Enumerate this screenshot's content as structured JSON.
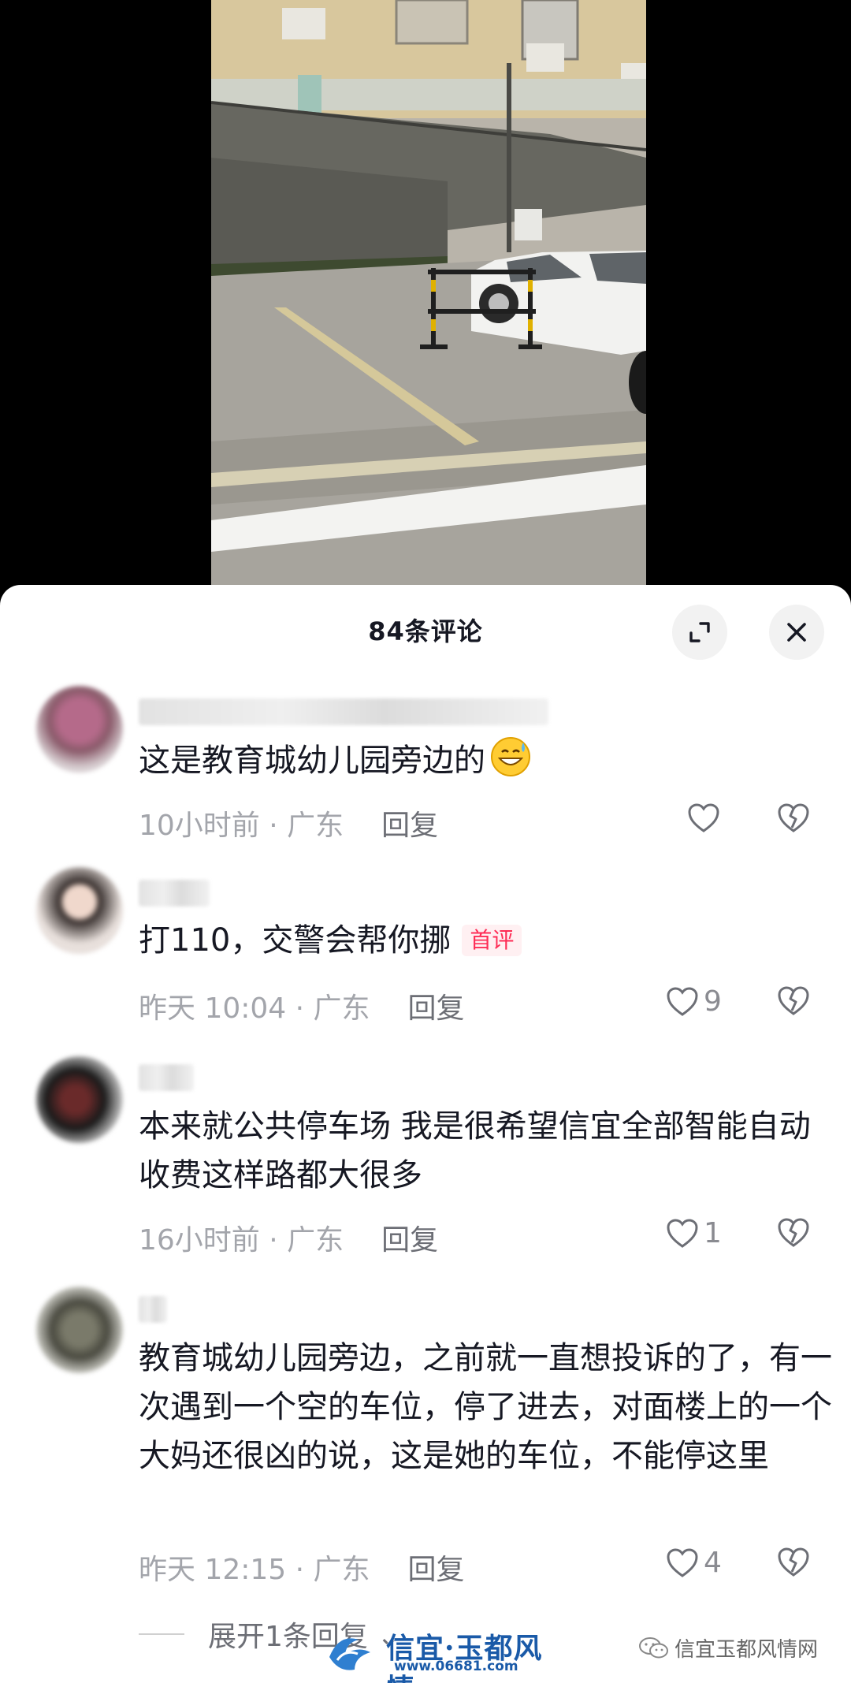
{
  "header": {
    "title": "84条评论"
  },
  "comments": [
    {
      "text": "这是教育城幼儿园旁边的",
      "time": "10小时前 · 广东",
      "reply_label": "回复",
      "likes": "",
      "badge": ""
    },
    {
      "text": "打110，交警会帮你挪",
      "time": "昨天 10:04 · 广东",
      "reply_label": "回复",
      "likes": "9",
      "badge": "首评"
    },
    {
      "text": "本来就公共停车场 我是很希望信宜全部智能自动收费这样路都大很多",
      "time": "16小时前 · 广东",
      "reply_label": "回复",
      "likes": "1",
      "badge": ""
    },
    {
      "text": "教育城幼儿园旁边，之前就一直想投诉的了，有一次遇到一个空的车位，停了进去，对面楼上的一个大妈还很凶的说，这是她的车位，不能停这里",
      "time": "昨天 12:15 · 广东",
      "reply_label": "回复",
      "likes": "4",
      "badge": ""
    }
  ],
  "expand_replies": "展开1条回复 ⌄",
  "watermarks": {
    "site_name": "信宜·玉都风情",
    "site_url": "www.06681.com",
    "account": "信宜玉都风情网"
  },
  "colors": {
    "accent": "#fe2c55",
    "text_primary": "#161823",
    "text_secondary": "#a3a5ab"
  },
  "icons": [
    "expand-icon",
    "close-icon",
    "heart-icon",
    "dislike-heart-icon",
    "grin-sweat-emoji",
    "wechat-icon"
  ]
}
